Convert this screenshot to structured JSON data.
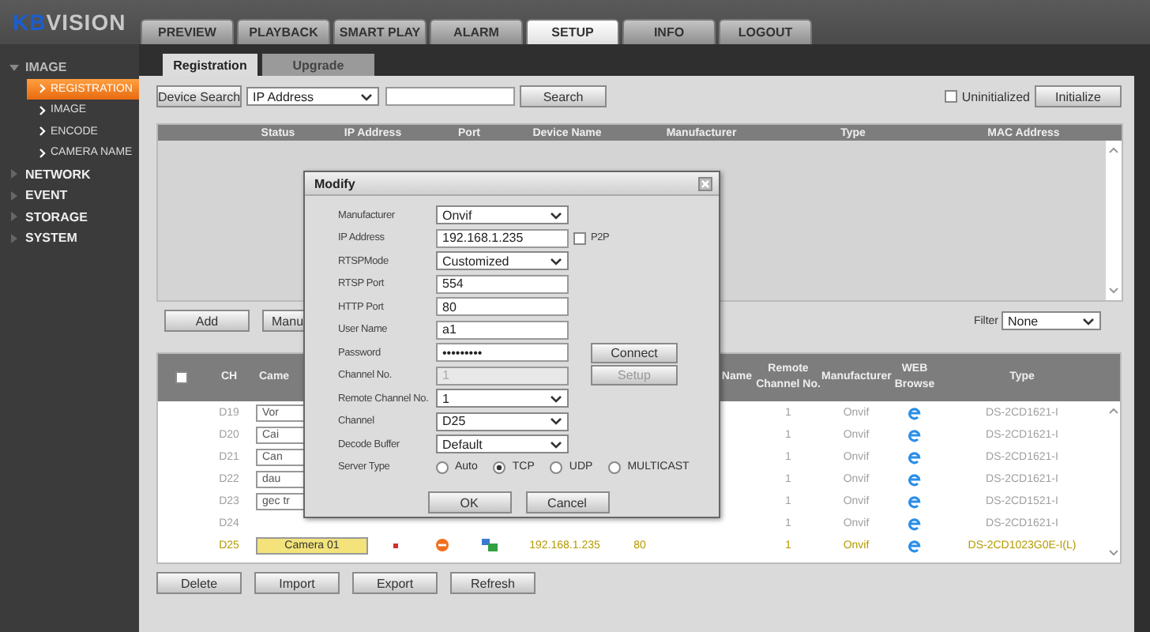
{
  "logo": {
    "prefix": "KB",
    "rest": "VISION"
  },
  "top_tabs": [
    {
      "label": "PREVIEW",
      "selected": false
    },
    {
      "label": "PLAYBACK",
      "selected": false
    },
    {
      "label": "SMART PLAY",
      "selected": false
    },
    {
      "label": "ALARM",
      "selected": false
    },
    {
      "label": "SETUP",
      "selected": true
    },
    {
      "label": "INFO",
      "selected": false
    },
    {
      "label": "LOGOUT",
      "selected": false
    }
  ],
  "sidebar": {
    "items": [
      {
        "label": "IMAGE",
        "expanded": true,
        "children": [
          {
            "label": "REGISTRATION",
            "selected": true
          },
          {
            "label": "IMAGE",
            "selected": false
          },
          {
            "label": "ENCODE",
            "selected": false
          },
          {
            "label": "CAMERA NAME",
            "selected": false
          }
        ]
      },
      {
        "label": "NETWORK",
        "expanded": false
      },
      {
        "label": "EVENT",
        "expanded": false
      },
      {
        "label": "STORAGE",
        "expanded": false
      },
      {
        "label": "SYSTEM",
        "expanded": false
      }
    ]
  },
  "sub_tabs": [
    {
      "label": "Registration",
      "selected": true
    },
    {
      "label": "Upgrade",
      "selected": false
    }
  ],
  "search_bar": {
    "button": "Device Search",
    "mode": "IP Address",
    "search_button": "Search",
    "uninitialized": {
      "label": "Uninitialized",
      "checked": false
    },
    "initialize_button": "Initialize"
  },
  "device_table": {
    "columns": [
      "Status",
      "IP Address",
      "Port",
      "Device Name",
      "Manufacturer",
      "Type",
      "MAC Address"
    ]
  },
  "middle_buttons": [
    "Add",
    "Manu"
  ],
  "filter": {
    "label": "Filter",
    "value": "None"
  },
  "added_table": {
    "select_all_checked": false,
    "columns": [
      "CH",
      "Came",
      "",
      "",
      "",
      "",
      "",
      "Name",
      "Remote Channel No.",
      "Manufacturer",
      "WEB Browse",
      "Type"
    ],
    "rows": [
      {
        "ch": "D19",
        "camera_name": "Vor",
        "highlighted": false,
        "remote_channel": "1",
        "manufacturer": "Onvif",
        "type": "DS-2CD1621-I"
      },
      {
        "ch": "D20",
        "camera_name": "Cai",
        "highlighted": false,
        "remote_channel": "1",
        "manufacturer": "Onvif",
        "type": "DS-2CD1621-I"
      },
      {
        "ch": "D21",
        "camera_name": "Can",
        "highlighted": false,
        "remote_channel": "1",
        "manufacturer": "Onvif",
        "type": "DS-2CD1621-I"
      },
      {
        "ch": "D22",
        "camera_name": "dau",
        "highlighted": false,
        "remote_channel": "1",
        "manufacturer": "Onvif",
        "type": "DS-2CD1621-I"
      },
      {
        "ch": "D23",
        "camera_name": "gec tr",
        "highlighted": false,
        "remote_channel": "1",
        "manufacturer": "Onvif",
        "type": "DS-2CD1521-I"
      },
      {
        "ch": "D24",
        "highlighted": false,
        "remote_channel": "1",
        "manufacturer": "Onvif",
        "type": "DS-2CD1621-I"
      },
      {
        "ch": "D25",
        "camera_name": "Camera 01",
        "highlighted": true,
        "status_icons": true,
        "ip": "192.168.1.235",
        "port": "80",
        "remote_channel": "1",
        "manufacturer": "Onvif",
        "type": "DS-2CD1023G0E-I(L)"
      }
    ]
  },
  "bottom_buttons": [
    "Delete",
    "Import",
    "Export",
    "Refresh"
  ],
  "dialog": {
    "title": "Modify",
    "fields": [
      {
        "label": "Manufacturer",
        "kind": "select",
        "value": "Onvif"
      },
      {
        "label": "IP Address",
        "kind": "text",
        "value": "192.168.1.235",
        "option": {
          "label": "P2P",
          "checked": false
        }
      },
      {
        "label": "RTSPMode",
        "kind": "select",
        "value": "Customized"
      },
      {
        "label": "RTSP Port",
        "kind": "text",
        "value": "554"
      },
      {
        "label": "HTTP Port",
        "kind": "text",
        "value": "80"
      },
      {
        "label": "User Name",
        "kind": "text",
        "value": "a1"
      },
      {
        "label": "Password",
        "kind": "text",
        "value": "•••••••••"
      },
      {
        "label": "Channel No.",
        "kind": "text",
        "value": "1",
        "disabled": true
      },
      {
        "label": "Remote Channel No.",
        "kind": "select",
        "value": "1"
      },
      {
        "label": "Channel",
        "kind": "select",
        "value": "D25"
      },
      {
        "label": "Decode Buffer",
        "kind": "select",
        "value": "Default"
      },
      {
        "label": "Server Type",
        "kind": "radio",
        "options": [
          {
            "label": "Auto",
            "selected": false
          },
          {
            "label": "TCP",
            "selected": true
          },
          {
            "label": "UDP",
            "selected": false
          },
          {
            "label": "MULTICAST",
            "selected": false
          }
        ]
      }
    ],
    "side_buttons": [
      {
        "label": "Connect",
        "disabled": false
      },
      {
        "label": "Setup",
        "disabled": true
      }
    ],
    "buttons": [
      "OK",
      "Cancel"
    ]
  }
}
